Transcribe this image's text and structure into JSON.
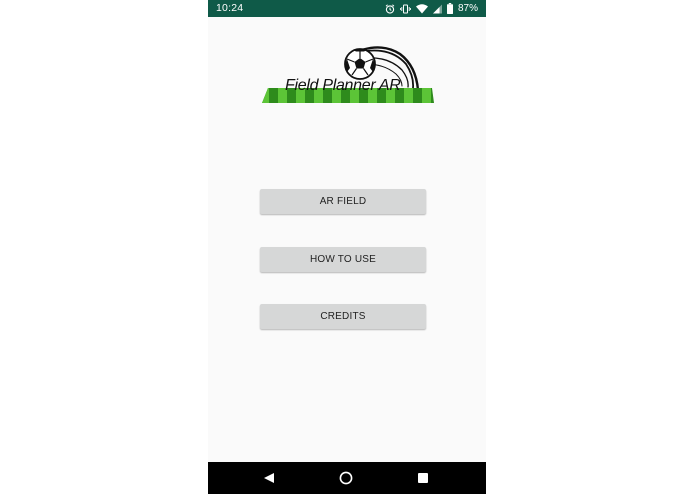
{
  "status_bar": {
    "time": "10:24",
    "battery": "87%",
    "icons": [
      "alarm-icon",
      "vibrate-icon",
      "wifi-icon",
      "signal-icon",
      "battery-icon"
    ]
  },
  "logo": {
    "text": "Field Planner AR",
    "icons": [
      "soccer-ball-icon",
      "grass-field-icon"
    ]
  },
  "menu": {
    "ar_field": "AR FIELD",
    "how_to_use": "HOW TO USE",
    "credits": "CREDITS"
  },
  "nav_bar": {
    "icons": [
      "back-icon",
      "home-icon",
      "recents-icon"
    ]
  },
  "colors": {
    "status_bar": "#0f5a48",
    "background": "#fafafa",
    "button": "#d6d7d7",
    "grass_dark": "#2e8b1c",
    "grass_light": "#5cc437"
  }
}
